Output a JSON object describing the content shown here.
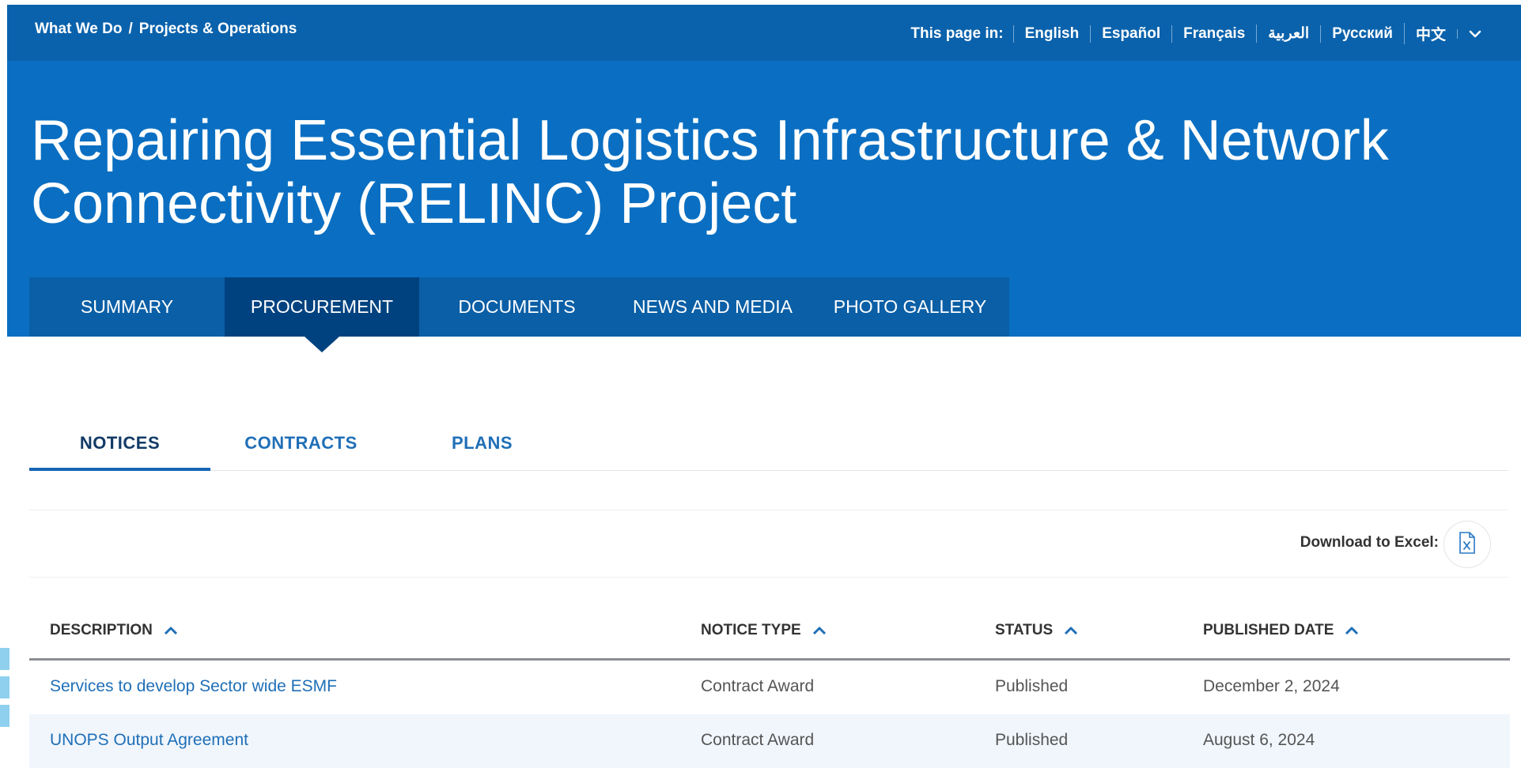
{
  "breadcrumb": {
    "items": [
      "What We Do",
      "Projects & Operations"
    ],
    "separator": "/"
  },
  "language": {
    "label": "This page in:",
    "options": [
      "English",
      "Español",
      "Français",
      "العربية",
      "Русский",
      "中文"
    ],
    "more_icon": "chevron-down-icon"
  },
  "page": {
    "title": "Repairing Essential Logistics Infrastructure & Network Connectivity (RELINC) Project"
  },
  "main_tabs": [
    {
      "label": "SUMMARY",
      "active": false
    },
    {
      "label": "PROCUREMENT",
      "active": true
    },
    {
      "label": "DOCUMENTS",
      "active": false
    },
    {
      "label": "NEWS AND MEDIA",
      "active": false
    },
    {
      "label": "PHOTO GALLERY",
      "active": false
    }
  ],
  "sub_tabs": [
    {
      "label": "NOTICES",
      "active": true
    },
    {
      "label": "CONTRACTS",
      "active": false
    },
    {
      "label": "PLANS",
      "active": false
    }
  ],
  "download": {
    "label": "Download to Excel:",
    "icon": "excel-file-icon"
  },
  "table": {
    "columns": [
      "DESCRIPTION",
      "NOTICE TYPE",
      "STATUS",
      "PUBLISHED DATE"
    ],
    "sort_icon": "chevron-up-icon",
    "rows": [
      [
        "Services to develop Sector wide ESMF",
        "Contract Award",
        "Published",
        "December 2, 2024"
      ],
      [
        "UNOPS Output Agreement",
        "Contract Award",
        "Published",
        "August 6, 2024"
      ]
    ]
  },
  "colors": {
    "hero_blue": "#0a6fc2",
    "topbar_blue": "#0a62ac",
    "tab_blue": "#0a5fa6",
    "tab_active": "#00427f",
    "link_blue": "#1f6fb7"
  }
}
